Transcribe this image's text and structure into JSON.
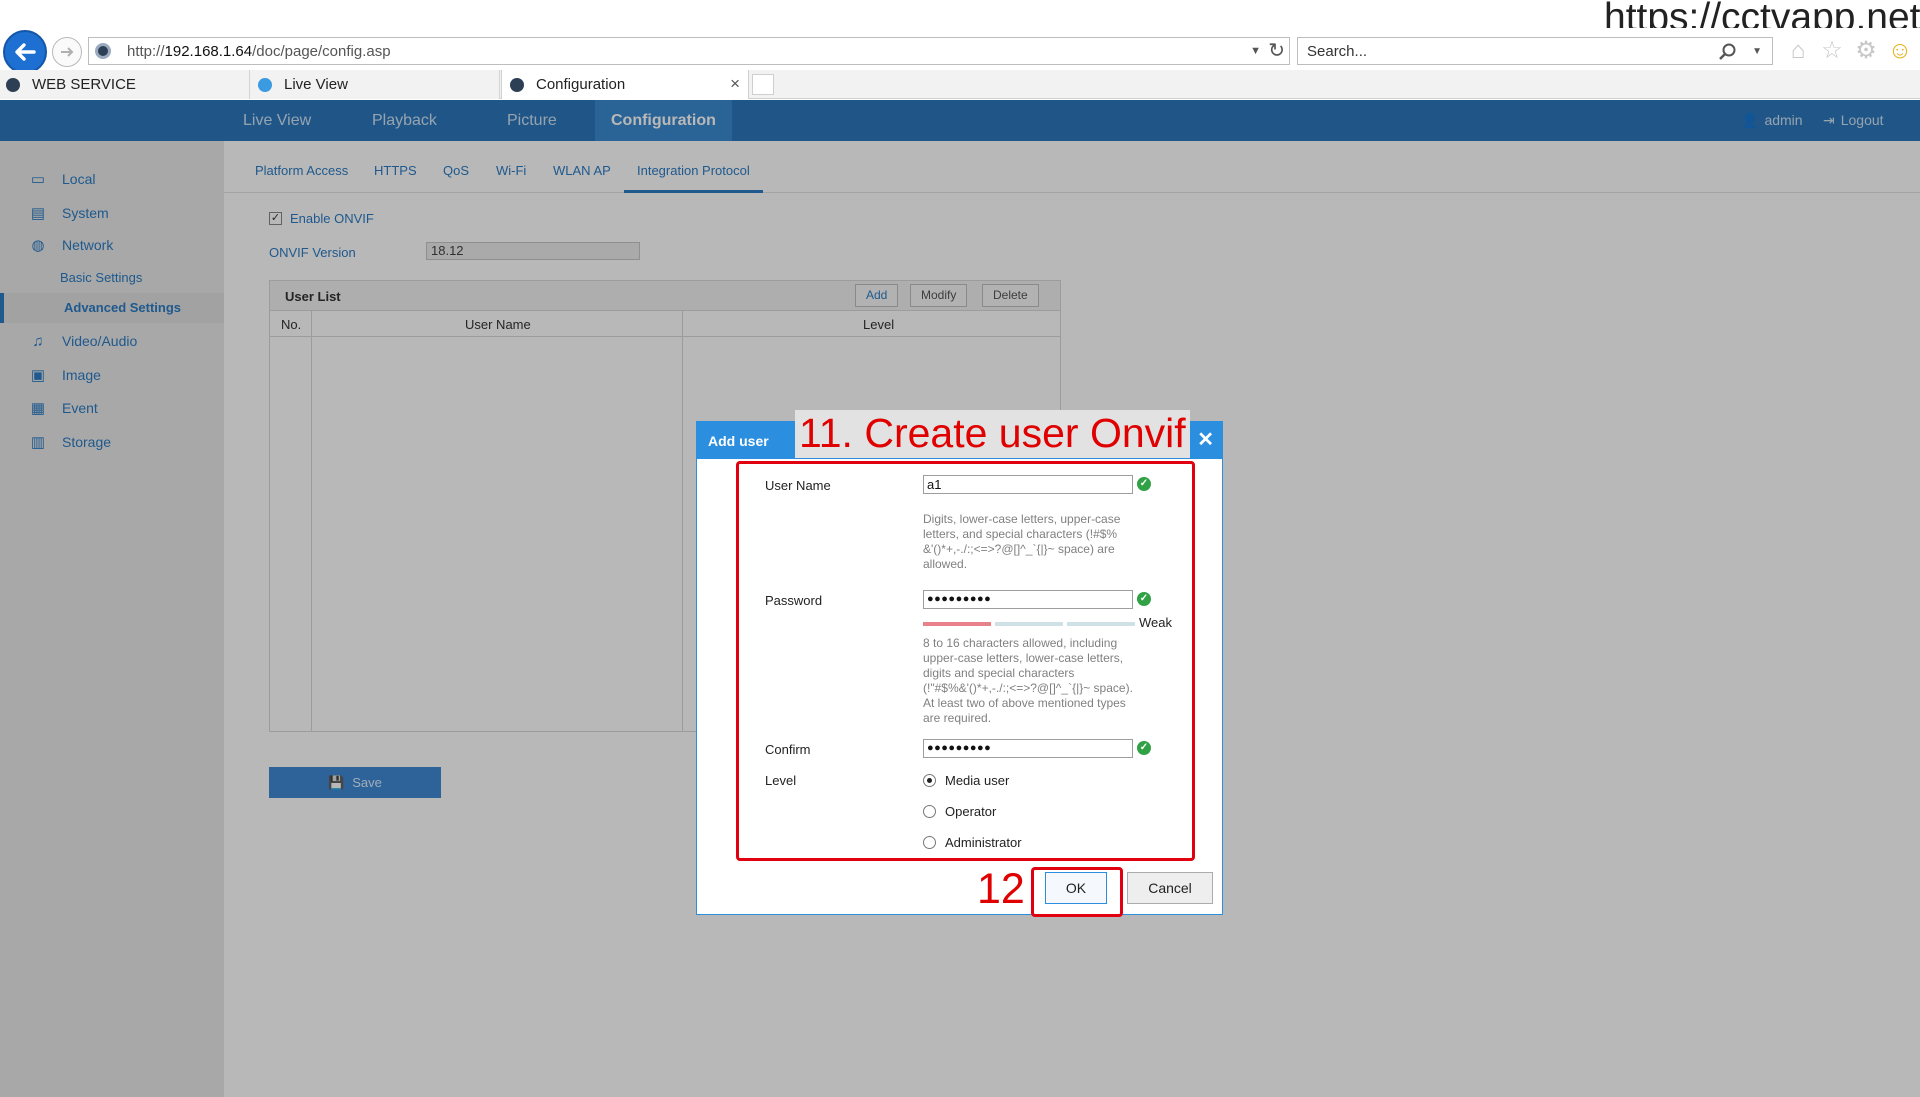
{
  "browser": {
    "url_prefix": "http://",
    "url_host": "192.168.1.64",
    "url_path": "/doc/page/config.asp",
    "search_placeholder": "Search...",
    "tabs": [
      {
        "label": "WEB SERVICE"
      },
      {
        "label": "Live View"
      },
      {
        "label": "Configuration"
      }
    ]
  },
  "watermark": "https://cctvapp.net",
  "nav": {
    "items": [
      "Live View",
      "Playback",
      "Picture",
      "Configuration"
    ],
    "active": "Configuration",
    "user": "admin",
    "logout": "Logout"
  },
  "sidebar": {
    "items": [
      {
        "label": "Local",
        "icon": "monitor-icon"
      },
      {
        "label": "System",
        "icon": "system-icon"
      },
      {
        "label": "Network",
        "icon": "globe-icon"
      },
      {
        "label": "Video/Audio",
        "icon": "video-audio-icon"
      },
      {
        "label": "Image",
        "icon": "image-icon"
      },
      {
        "label": "Event",
        "icon": "calendar-icon"
      },
      {
        "label": "Storage",
        "icon": "storage-icon"
      }
    ],
    "sub_items": [
      {
        "label": "Basic Settings"
      },
      {
        "label": "Advanced Settings"
      }
    ]
  },
  "subtabs": [
    "Platform Access",
    "HTTPS",
    "QoS",
    "Wi-Fi",
    "WLAN AP",
    "Integration Protocol"
  ],
  "onvif": {
    "enable_label": "Enable ONVIF",
    "enabled": true,
    "version_label": "ONVIF Version",
    "version_value": "18.12"
  },
  "user_list": {
    "title": "User List",
    "add": "Add",
    "modify": "Modify",
    "delete": "Delete",
    "columns": [
      "No.",
      "User Name",
      "Level"
    ]
  },
  "save_label": "Save",
  "dialog": {
    "title": "Add user",
    "annotation": "11. Create user Onvif",
    "step_12": "12",
    "username_label": "User Name",
    "username_value": "a1",
    "username_hint": "Digits, lower-case letters, upper-case letters, and special characters (!#$% &'()*+,-./:;<=>?@[]^_`{|}~ space) are allowed.",
    "password_label": "Password",
    "password_value": "●●●●●●●●●",
    "strength": "Weak",
    "strength_level": 1,
    "password_hint": "8 to 16 characters allowed, including upper-case letters, lower-case letters, digits and special characters (!\"#$%&'()*+,-./:;<=>?@[]^_`{|}~ space). At least two of above mentioned types are required.",
    "confirm_label": "Confirm",
    "confirm_value": "●●●●●●●●●",
    "level_label": "Level",
    "levels": [
      "Media user",
      "Operator",
      "Administrator"
    ],
    "selected_level": "Media user",
    "ok": "OK",
    "cancel": "Cancel"
  },
  "colors": {
    "accent": "#2b8ede",
    "annotation_red": "#e00000",
    "valid_green": "#30a245"
  }
}
